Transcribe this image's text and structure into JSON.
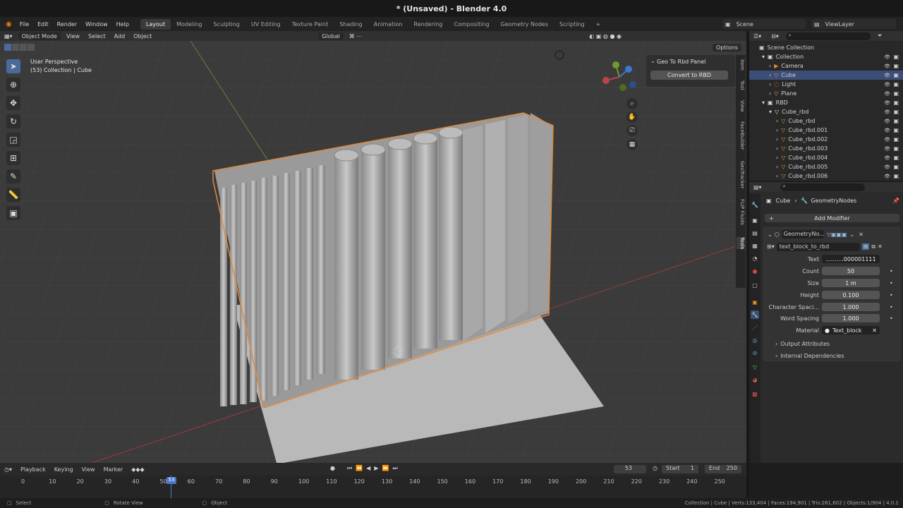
{
  "window": {
    "title": "* (Unsaved) - Blender 4.0"
  },
  "menu": {
    "file": "File",
    "edit": "Edit",
    "render": "Render",
    "window": "Window",
    "help": "Help"
  },
  "workspaces": [
    "Layout",
    "Modeling",
    "Sculpting",
    "UV Editing",
    "Texture Paint",
    "Shading",
    "Animation",
    "Rendering",
    "Compositing",
    "Geometry Nodes",
    "Scripting"
  ],
  "scene": {
    "label": "Scene",
    "viewlayer": "ViewLayer"
  },
  "viewport": {
    "mode": "Object Mode",
    "menus": [
      "View",
      "Select",
      "Add",
      "Object"
    ],
    "orientation": "Global",
    "options": "Options",
    "perspective": "User Perspective",
    "context": "(53) Collection | Cube",
    "panel_title": "Geo To Rbd Panel",
    "panel_button": "Convert to RBD",
    "tabs": [
      "Item",
      "Tool",
      "View",
      "FaceBuilder",
      "GeoTracker",
      "FLIP Fluids",
      "Tools"
    ]
  },
  "outliner": {
    "root": "Scene Collection",
    "rows": [
      {
        "label": "Collection",
        "indent": 1
      },
      {
        "label": "Camera",
        "indent": 2
      },
      {
        "label": "Cube",
        "indent": 2
      },
      {
        "label": "Light",
        "indent": 2
      },
      {
        "label": "Plane",
        "indent": 2
      },
      {
        "label": "RBD",
        "indent": 1
      },
      {
        "label": "Cube_rbd",
        "indent": 2
      },
      {
        "label": "Cube_rbd",
        "indent": 3
      },
      {
        "label": "Cube_rbd.001",
        "indent": 3
      },
      {
        "label": "Cube_rbd.002",
        "indent": 3
      },
      {
        "label": "Cube_rbd.003",
        "indent": 3
      },
      {
        "label": "Cube_rbd.004",
        "indent": 3
      },
      {
        "label": "Cube_rbd.005",
        "indent": 3
      },
      {
        "label": "Cube_rbd.006",
        "indent": 3
      }
    ]
  },
  "properties": {
    "breadcrumb_object": "Cube",
    "breadcrumb_modifier": "GeometryNodes",
    "add_modifier": "Add Modifier",
    "modifier_name": "GeometryNo...",
    "node_group": "text_block_to_rbd",
    "fields": [
      {
        "label": "Text",
        "value": "..........000001111"
      },
      {
        "label": "Count",
        "value": "50"
      },
      {
        "label": "Size",
        "value": "1 m"
      },
      {
        "label": "Height",
        "value": "0.100"
      },
      {
        "label": "Character Spaci...",
        "value": "1.000"
      },
      {
        "label": "Word Spacing",
        "value": "1.000"
      },
      {
        "label": "Material",
        "value": "Text_block"
      }
    ],
    "sections": [
      "Output Attributes",
      "Internal Dependencies"
    ]
  },
  "timeline": {
    "menus": [
      "Playback",
      "Keying",
      "View",
      "Marker"
    ],
    "current_frame": "53",
    "start_label": "Start",
    "start": "1",
    "end_label": "End",
    "end": "250",
    "ticks": [
      "0",
      "10",
      "20",
      "30",
      "40",
      "50",
      "60",
      "70",
      "80",
      "90",
      "100",
      "110",
      "120",
      "130",
      "140",
      "150",
      "160",
      "170",
      "180",
      "190",
      "200",
      "210",
      "220",
      "230",
      "240",
      "250"
    ]
  },
  "status": {
    "select": "Select",
    "rotate": "Rotate View",
    "object": "Object",
    "stats": "Collection | Cube | Verts:133,404 | Faces:194,901 | Tris:261,602 | Objects:1/904 | 4.0.1"
  }
}
